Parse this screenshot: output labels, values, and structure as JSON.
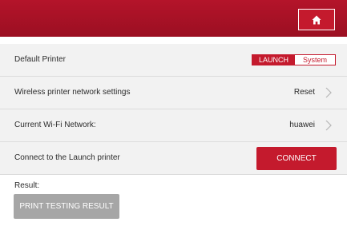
{
  "header": {
    "home_icon": "home-icon",
    "accent_color": "#c41a2d"
  },
  "rows": [
    {
      "label": "Default Printer",
      "options": [
        "LAUNCH",
        "System"
      ],
      "selected": "LAUNCH"
    },
    {
      "label": "Wireless printer network settings",
      "value": "Reset"
    },
    {
      "label": "Current Wi-Fi Network:",
      "value": "huawei"
    },
    {
      "label": "Connect to the Launch printer",
      "button": "CONNECT"
    }
  ],
  "result": {
    "label": "Result:",
    "print_button": "PRINT TESTING RESULT"
  }
}
